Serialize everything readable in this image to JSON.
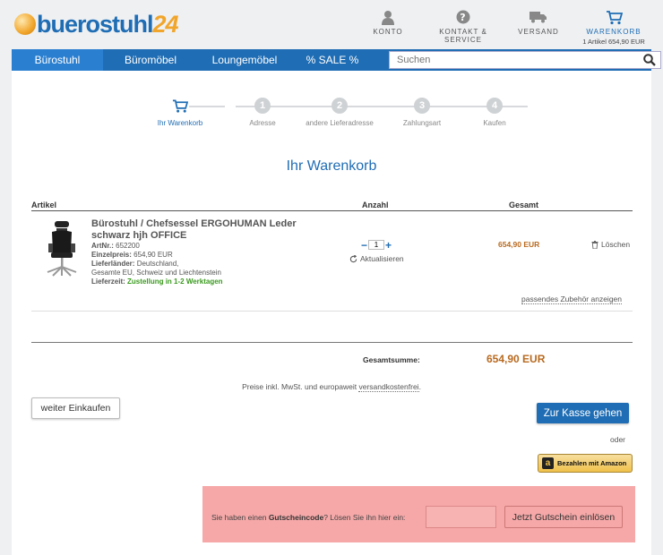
{
  "brand": {
    "name": "buerostuhl",
    "suffix": "24"
  },
  "header_nav": {
    "konto": "KONTO",
    "kontakt": "KONTAKT & SERVICE",
    "versand": "VERSAND",
    "warenkorb": "WARENKORB",
    "warenkorb_sub": "1 Artikel  654,90 EUR"
  },
  "menu": {
    "items": [
      "Bürostuhl",
      "Büromöbel",
      "Loungemöbel",
      "% SALE %"
    ],
    "active": "Bürostuhl"
  },
  "search": {
    "placeholder": "Suchen",
    "value": ""
  },
  "steps": [
    {
      "num": "",
      "label": "Ihr Warenkorb",
      "current": true
    },
    {
      "num": "1",
      "label": "Adresse",
      "current": false
    },
    {
      "num": "2",
      "label": "andere Lieferadresse",
      "current": false
    },
    {
      "num": "3",
      "label": "Zahlungsart",
      "current": false
    },
    {
      "num": "4",
      "label": "Kaufen",
      "current": false
    }
  ],
  "page_title": "Ihr Warenkorb",
  "table_headers": {
    "artikel": "Artikel",
    "anzahl": "Anzahl",
    "gesamt": "Gesamt"
  },
  "product": {
    "title": "Bürostuhl / Chefsessel ERGOHUMAN Leder schwarz hjh OFFICE",
    "artnr_label": "ArtNr.:",
    "artnr": "652200",
    "einzelpreis_label": "Einzelpreis:",
    "einzelpreis": "654,90 EUR",
    "lieferlaender_label": "Lieferländer:",
    "lieferlaender_1": "Deutschland,",
    "lieferlaender_2": "Gesamte EU, Schweiz und Liechtenstein",
    "lieferzeit_label": "Lieferzeit:",
    "lieferzeit": "Zustellung in 1-2 Werktagen",
    "quantity": "1",
    "aktualisieren": "Aktualisieren",
    "price_total": "654,90 EUR",
    "delete": "Löschen",
    "zubehoer": "passendes Zubehör anzeigen"
  },
  "summary": {
    "label": "Gesamtsumme:",
    "value": "654,90 EUR"
  },
  "shipping_note": {
    "text": "Preise inkl. MwSt. und europaweit ",
    "link": "versandkostenfrei",
    "end": "."
  },
  "buttons": {
    "weiter": "weiter Einkaufen",
    "kasse": "Zur Kasse gehen",
    "oder": "oder",
    "amazon": "Bezahlen mit Amazon"
  },
  "voucher": {
    "text_1": "Sie haben einen ",
    "text_bold": "Gutscheincode",
    "text_2": "? Lösen Sie ihn hier ein:",
    "input_value": "",
    "button": "Jetzt Gutschein einlösen"
  },
  "colors": {
    "brand_blue": "#1f6db4",
    "price_orange": "#b86a1f",
    "voucher_bg": "#f6a8a8"
  }
}
